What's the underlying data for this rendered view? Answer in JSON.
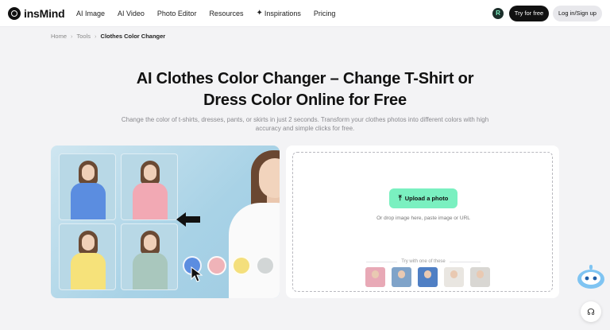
{
  "brand": {
    "name": "insMind"
  },
  "nav": {
    "items": [
      {
        "label": "AI Image"
      },
      {
        "label": "AI Video"
      },
      {
        "label": "Photo Editor"
      },
      {
        "label": "Resources"
      },
      {
        "label": "Inspirations",
        "icon": "sparkle-icon"
      },
      {
        "label": "Pricing"
      }
    ],
    "badge": "R",
    "try_label": "Try for free",
    "login_label": "Log in/Sign up"
  },
  "breadcrumb": {
    "items": [
      "Home",
      "Tools",
      "Clothes Color Changer"
    ]
  },
  "hero": {
    "title_line1": "AI Clothes Color Changer – Change T-Shirt or",
    "title_line2": "Dress Color Online for Free",
    "subtitle_line1": "Change the color of t-shirts, dresses, pants, or skirts in just 2 seconds. Transform your clothes photos into different colors with high",
    "subtitle_line2": "accuracy and simple clicks for free."
  },
  "showcase": {
    "shirt_colors": [
      "#5b8de0",
      "#f2a9b4",
      "#f6e27a",
      "#a9c7bd"
    ],
    "swatches": [
      "#5b8de0",
      "#efb3b8",
      "#f4df7c",
      "#d2d6d6"
    ]
  },
  "upload": {
    "button_label": "Upload a photo",
    "hint": "Or drop image here, paste image or URL",
    "try_label": "Try with one of these",
    "sample_colors": [
      "#e8a9b6",
      "#7fa3c9",
      "#4f7fc4",
      "#e9e6e1",
      "#d9d7d3"
    ]
  },
  "colors": {
    "accent": "#7af0c0",
    "dark": "#111111"
  }
}
